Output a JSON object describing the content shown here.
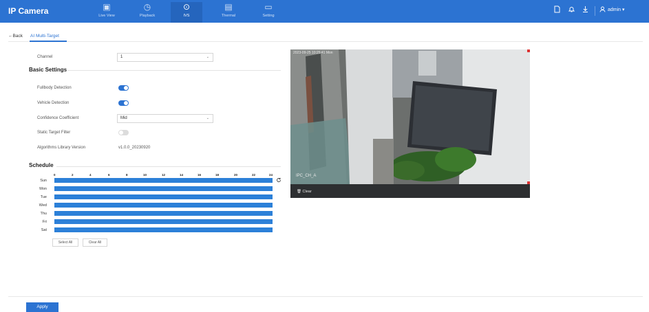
{
  "header": {
    "brand": "IP Camera",
    "nav": [
      {
        "label": "Live View",
        "icon": "monitor-icon",
        "glyph": "▣"
      },
      {
        "label": "Playback",
        "icon": "playback-icon",
        "glyph": "◷"
      },
      {
        "label": "IVS",
        "icon": "ivs-icon",
        "glyph": "⊙"
      },
      {
        "label": "Thermal",
        "icon": "thermal-icon",
        "glyph": "▤"
      },
      {
        "label": "Setting",
        "icon": "setting-icon",
        "glyph": "▭"
      }
    ],
    "active_nav": "IVS",
    "user": "admin ▾",
    "accent_color": "#2c73d2"
  },
  "tabs": {
    "back": "←Back",
    "active": "AI Multi-Target"
  },
  "form": {
    "channel_label": "Channel",
    "channel_value": "1",
    "basic_title": "Basic Settings",
    "fullbody_label": "Fullbody Detection",
    "fullbody_on": true,
    "vehicle_label": "Vehicle Detection",
    "vehicle_on": true,
    "confidence_label": "Confidence Coefficient",
    "confidence_value": "Mid",
    "static_label": "Static Target Filter",
    "static_on": false,
    "algo_label": "Algorithms Library Version",
    "algo_value": "v1.0.0_20230920"
  },
  "schedule": {
    "title": "Schedule",
    "ticks": [
      "0",
      "2",
      "4",
      "6",
      "8",
      "10",
      "12",
      "14",
      "16",
      "18",
      "20",
      "22",
      "24"
    ],
    "days": [
      "Sun",
      "Mon",
      "Tue",
      "Wed",
      "Thu",
      "Fri",
      "Sat"
    ],
    "select_all": "Select All",
    "clear_all": "Clear All"
  },
  "video": {
    "timestamp": "2023-09-25 10:25:41 Mon",
    "channel_osd": "IPC_CH_A",
    "clear_label": "Clear"
  },
  "apply_label": "Apply"
}
